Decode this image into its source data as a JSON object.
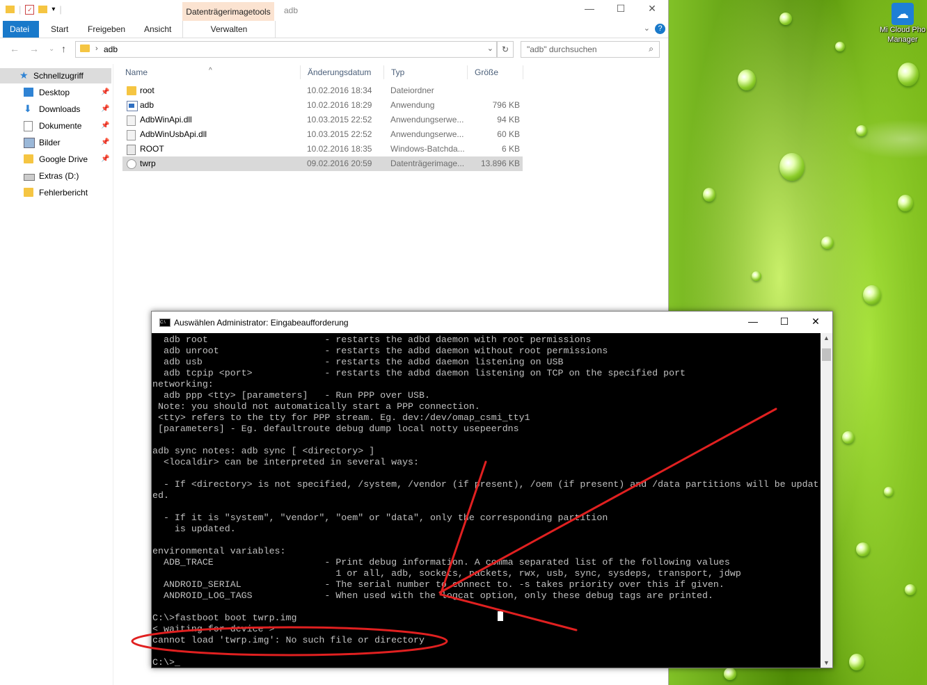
{
  "desktop": {
    "icon_label_1": "Mi Cloud Pho",
    "icon_label_2": "Manager"
  },
  "explorer": {
    "ribbon_context_tab": "Datenträgerimagetools",
    "window_title": "adb",
    "ribbon_tabs": [
      "Datei",
      "Start",
      "Freigeben",
      "Ansicht",
      "Verwalten"
    ],
    "address_path": "adb",
    "search_placeholder": "\"adb\" durchsuchen",
    "nav_items": [
      {
        "label": "Schnellzugriff",
        "icon": "star-icon"
      },
      {
        "label": "Desktop",
        "icon": "desktop-icon"
      },
      {
        "label": "Downloads",
        "icon": "download-icon"
      },
      {
        "label": "Dokumente",
        "icon": "documents-icon"
      },
      {
        "label": "Bilder",
        "icon": "pictures-icon"
      },
      {
        "label": "Google Drive",
        "icon": "folder-icon"
      },
      {
        "label": "Extras (D:)",
        "icon": "drive-icon"
      },
      {
        "label": "Fehlerbericht",
        "icon": "folder-icon"
      }
    ],
    "columns": [
      "Name",
      "Änderungsdatum",
      "Typ",
      "Größe"
    ],
    "files": [
      {
        "name": "root",
        "date": "10.02.2016 18:34",
        "type": "Dateiordner",
        "size": ""
      },
      {
        "name": "adb",
        "date": "10.02.2016 18:29",
        "type": "Anwendung",
        "size": "796 KB"
      },
      {
        "name": "AdbWinApi.dll",
        "date": "10.03.2015 22:52",
        "type": "Anwendungserwe...",
        "size": "94 KB"
      },
      {
        "name": "AdbWinUsbApi.dll",
        "date": "10.03.2015 22:52",
        "type": "Anwendungserwe...",
        "size": "60 KB"
      },
      {
        "name": "ROOT",
        "date": "10.02.2016 18:35",
        "type": "Windows-Batchda...",
        "size": "6 KB"
      },
      {
        "name": "twrp",
        "date": "09.02.2016 20:59",
        "type": "Datenträgerimage...",
        "size": "13.896 KB"
      }
    ]
  },
  "cmd": {
    "title": "Auswählen Administrator: Eingabeaufforderung",
    "lines": [
      "  adb root                     - restarts the adbd daemon with root permissions",
      "  adb unroot                   - restarts the adbd daemon without root permissions",
      "  adb usb                      - restarts the adbd daemon listening on USB",
      "  adb tcpip <port>             - restarts the adbd daemon listening on TCP on the specified port",
      "networking:",
      "  adb ppp <tty> [parameters]   - Run PPP over USB.",
      " Note: you should not automatically start a PPP connection.",
      " <tty> refers to the tty for PPP stream. Eg. dev:/dev/omap_csmi_tty1",
      " [parameters] - Eg. defaultroute debug dump local notty usepeerdns",
      "",
      "adb sync notes: adb sync [ <directory> ]",
      "  <localdir> can be interpreted in several ways:",
      "",
      "  - If <directory> is not specified, /system, /vendor (if present), /oem (if present) and /data partitions will be updat",
      "ed.",
      "",
      "  - If it is \"system\", \"vendor\", \"oem\" or \"data\", only the corresponding partition",
      "    is updated.",
      "",
      "environmental variables:",
      "  ADB_TRACE                    - Print debug information. A comma separated list of the following values",
      "                                 1 or all, adb, sockets, packets, rwx, usb, sync, sysdeps, transport, jdwp",
      "  ANDROID_SERIAL               - The serial number to connect to. -s takes priority over this if given.",
      "  ANDROID_LOG_TAGS             - When used with the logcat option, only these debug tags are printed.",
      "",
      "C:\\>fastboot boot twrp.img",
      "< waiting for device >",
      "cannot load 'twrp.img': No such file or directory",
      "",
      "C:\\>_"
    ]
  },
  "colors": {
    "annotation_red": "#e02020",
    "ribbon_file_tab": "#1979ca",
    "context_tab_bg": "#fbe3d1"
  }
}
